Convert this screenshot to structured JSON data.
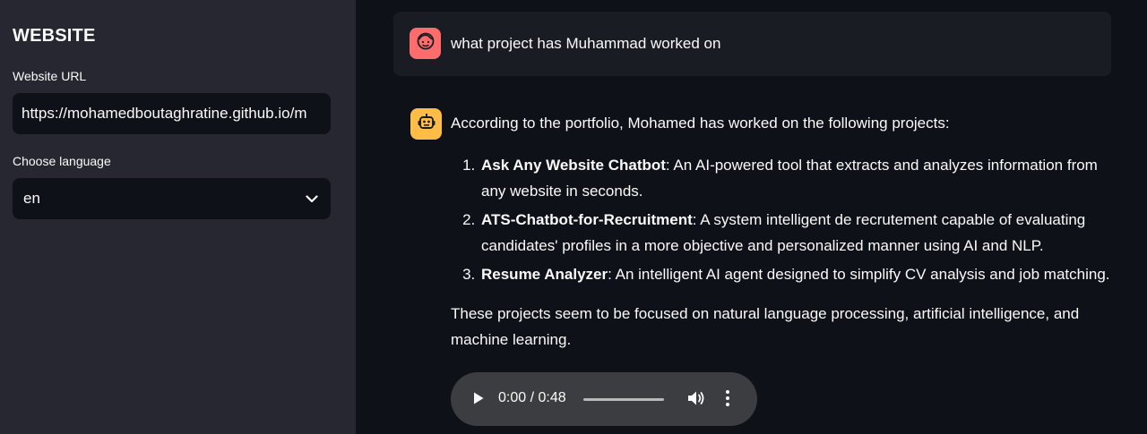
{
  "sidebar": {
    "title": "WEBSITE",
    "url_label": "Website URL",
    "url_value": "https://mohamedboutaghratine.github.io/m",
    "language_label": "Choose language",
    "language_value": "en"
  },
  "chat": {
    "user_message": "what project has Muhammad worked on",
    "assistant": {
      "intro": "According to the portfolio, Mohamed has worked on the following projects:",
      "projects": [
        {
          "name": "Ask Any Website Chatbot",
          "desc": ": An AI-powered tool that extracts and analyzes information from any website in seconds."
        },
        {
          "name": "ATS-Chatbot-for-Recruitment",
          "desc": ": A system intelligent de recrutement capable of evaluating candidates' profiles in a more objective and personalized manner using AI and NLP."
        },
        {
          "name": "Resume Analyzer",
          "desc": ": An intelligent AI agent designed to simplify CV analysis and job matching."
        }
      ],
      "closing": "These projects seem to be focused on natural language processing, artificial intelligence, and machine learning."
    },
    "audio": {
      "time": "0:00 / 0:48",
      "progress": 0
    }
  },
  "colors": {
    "sidebar_bg": "#262730",
    "main_bg": "#0e1117",
    "user_avatar": "#ff6c6c",
    "bot_avatar": "#ffbd45"
  },
  "icons": {
    "user_avatar": "face-icon",
    "bot_avatar": "robot-icon",
    "select": "chevron-down-icon",
    "play": "play-icon",
    "volume": "volume-icon",
    "more": "more-vertical-icon"
  }
}
